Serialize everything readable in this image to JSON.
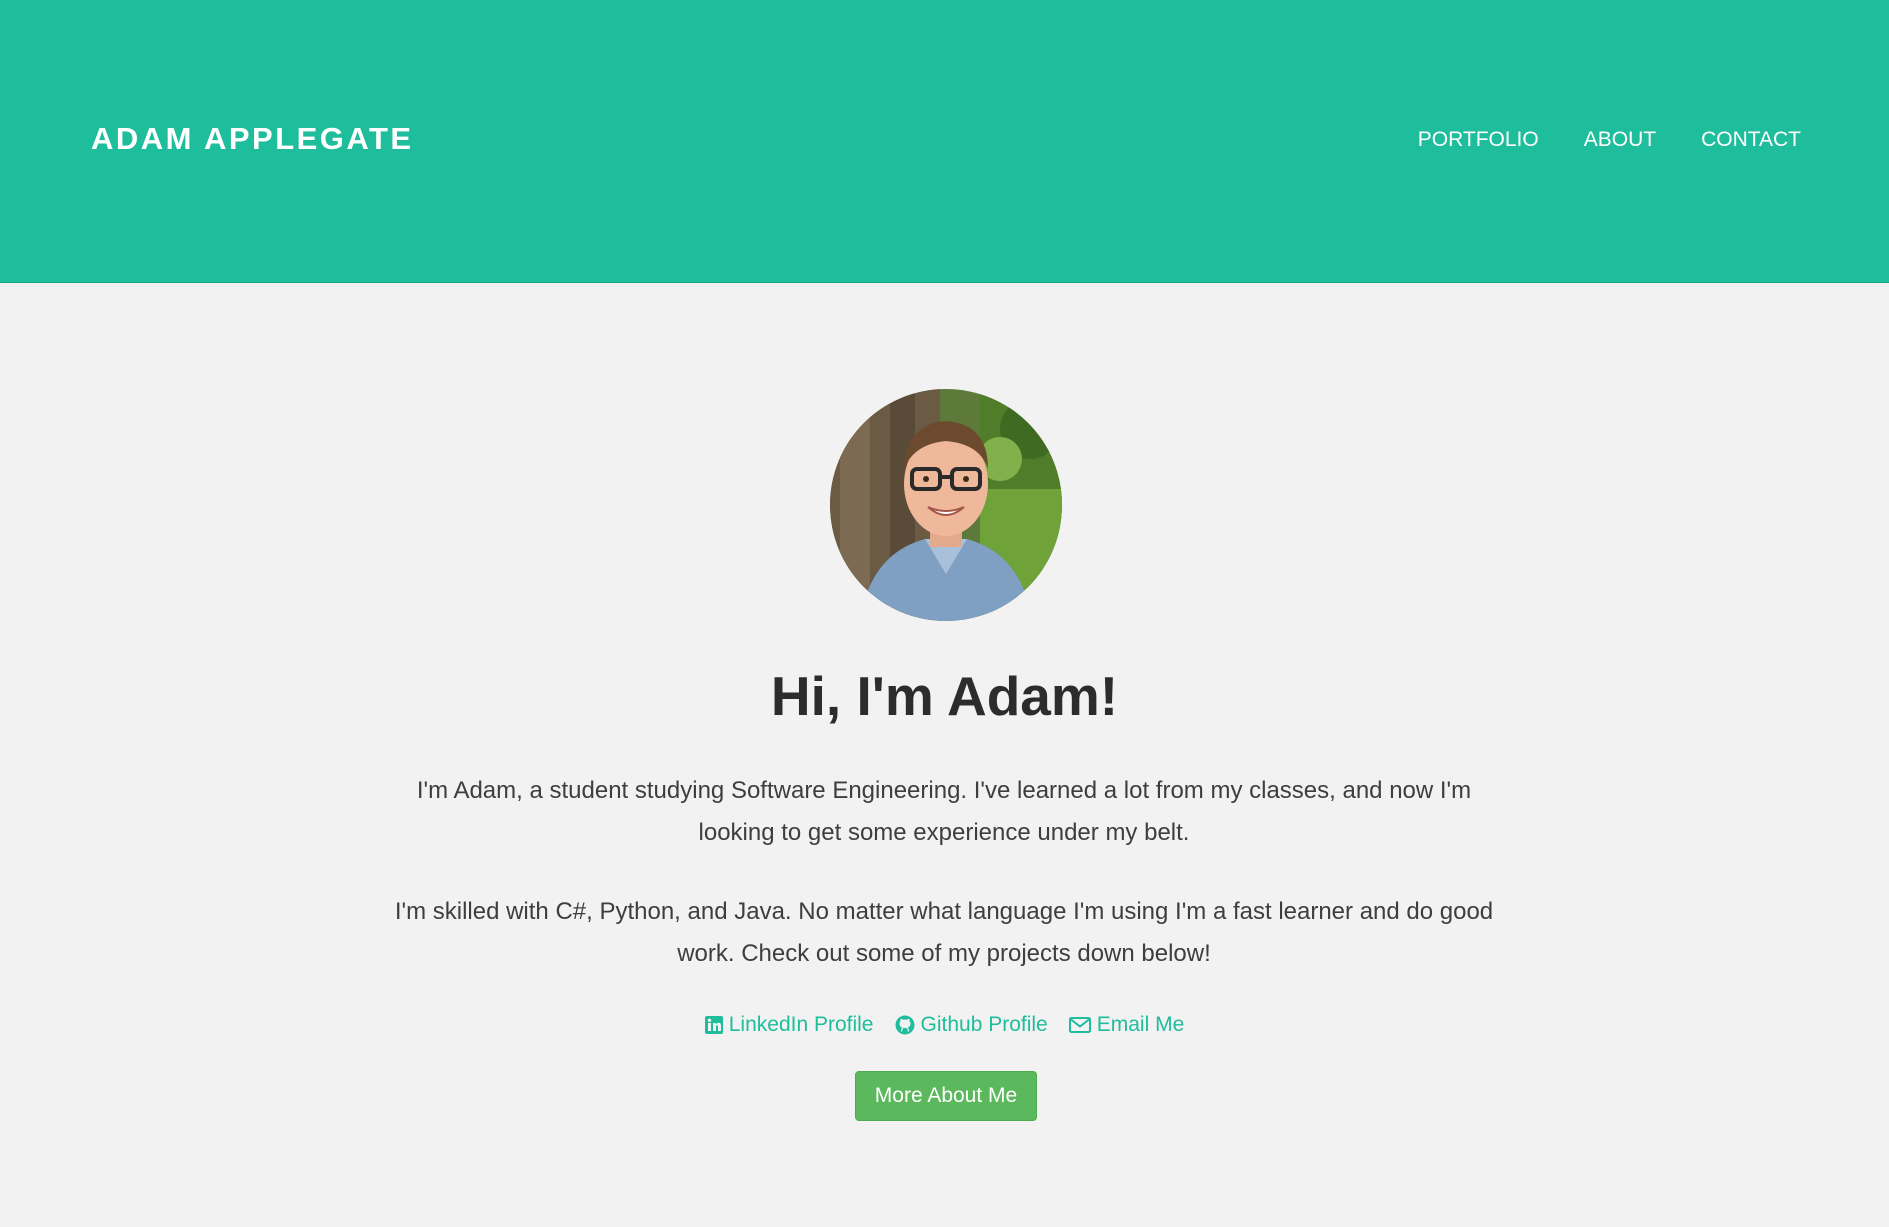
{
  "navbar": {
    "brand": "ADAM APPLEGATE",
    "links": [
      {
        "label": "PORTFOLIO"
      },
      {
        "label": "ABOUT"
      },
      {
        "label": "CONTACT"
      }
    ]
  },
  "hero": {
    "heading": "Hi, I'm Adam!",
    "paragraphs": [
      "I'm Adam, a student studying Software Engineering. I've learned a lot from my classes, and now I'm looking to get some experience under my belt.",
      "I'm skilled with C#, Python, and Java. No matter what language I'm using I'm a fast learner and do good work. Check out some of my projects down below!"
    ],
    "links": [
      {
        "label": "LinkedIn Profile",
        "icon": "linkedin-icon"
      },
      {
        "label": "Github Profile",
        "icon": "github-icon"
      },
      {
        "label": "Email Me",
        "icon": "envelope-icon"
      }
    ],
    "button_label": "More About Me"
  },
  "colors": {
    "navbar": "#1ebd9b",
    "background": "#f2f2f2",
    "link": "#1ebd9b",
    "button": "#5cb85c"
  }
}
